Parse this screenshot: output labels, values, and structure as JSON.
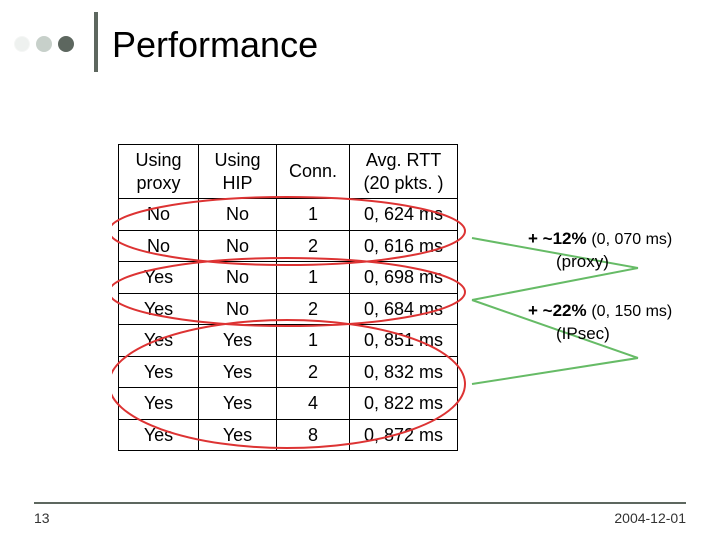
{
  "title": "Performance",
  "table": {
    "headers": {
      "proxy": "Using proxy",
      "hip": "Using HIP",
      "conn": "Conn.",
      "rtt": "Avg. RTT (20 pkts. )"
    },
    "rows": [
      {
        "proxy": "No",
        "hip": "No",
        "conn": "1",
        "rtt": "0, 624 ms"
      },
      {
        "proxy": "No",
        "hip": "No",
        "conn": "2",
        "rtt": "0, 616 ms"
      },
      {
        "proxy": "Yes",
        "hip": "No",
        "conn": "1",
        "rtt": "0, 698 ms"
      },
      {
        "proxy": "Yes",
        "hip": "No",
        "conn": "2",
        "rtt": "0, 684 ms"
      },
      {
        "proxy": "Yes",
        "hip": "Yes",
        "conn": "1",
        "rtt": "0, 851 ms"
      },
      {
        "proxy": "Yes",
        "hip": "Yes",
        "conn": "2",
        "rtt": "0, 832 ms"
      },
      {
        "proxy": "Yes",
        "hip": "Yes",
        "conn": "4",
        "rtt": "0, 822 ms"
      },
      {
        "proxy": "Yes",
        "hip": "Yes",
        "conn": "8",
        "rtt": "0, 872 ms"
      }
    ]
  },
  "annotations": {
    "proxy": {
      "prefix": "+ ~12%",
      "detail": "(0, 070 ms)",
      "sub": "(proxy)"
    },
    "ipsec": {
      "prefix": "+ ~22%",
      "detail": "(0, 150 ms)",
      "sub": "(IPsec)"
    }
  },
  "footer": {
    "slide_number": "13",
    "date": "2004-12-01"
  }
}
